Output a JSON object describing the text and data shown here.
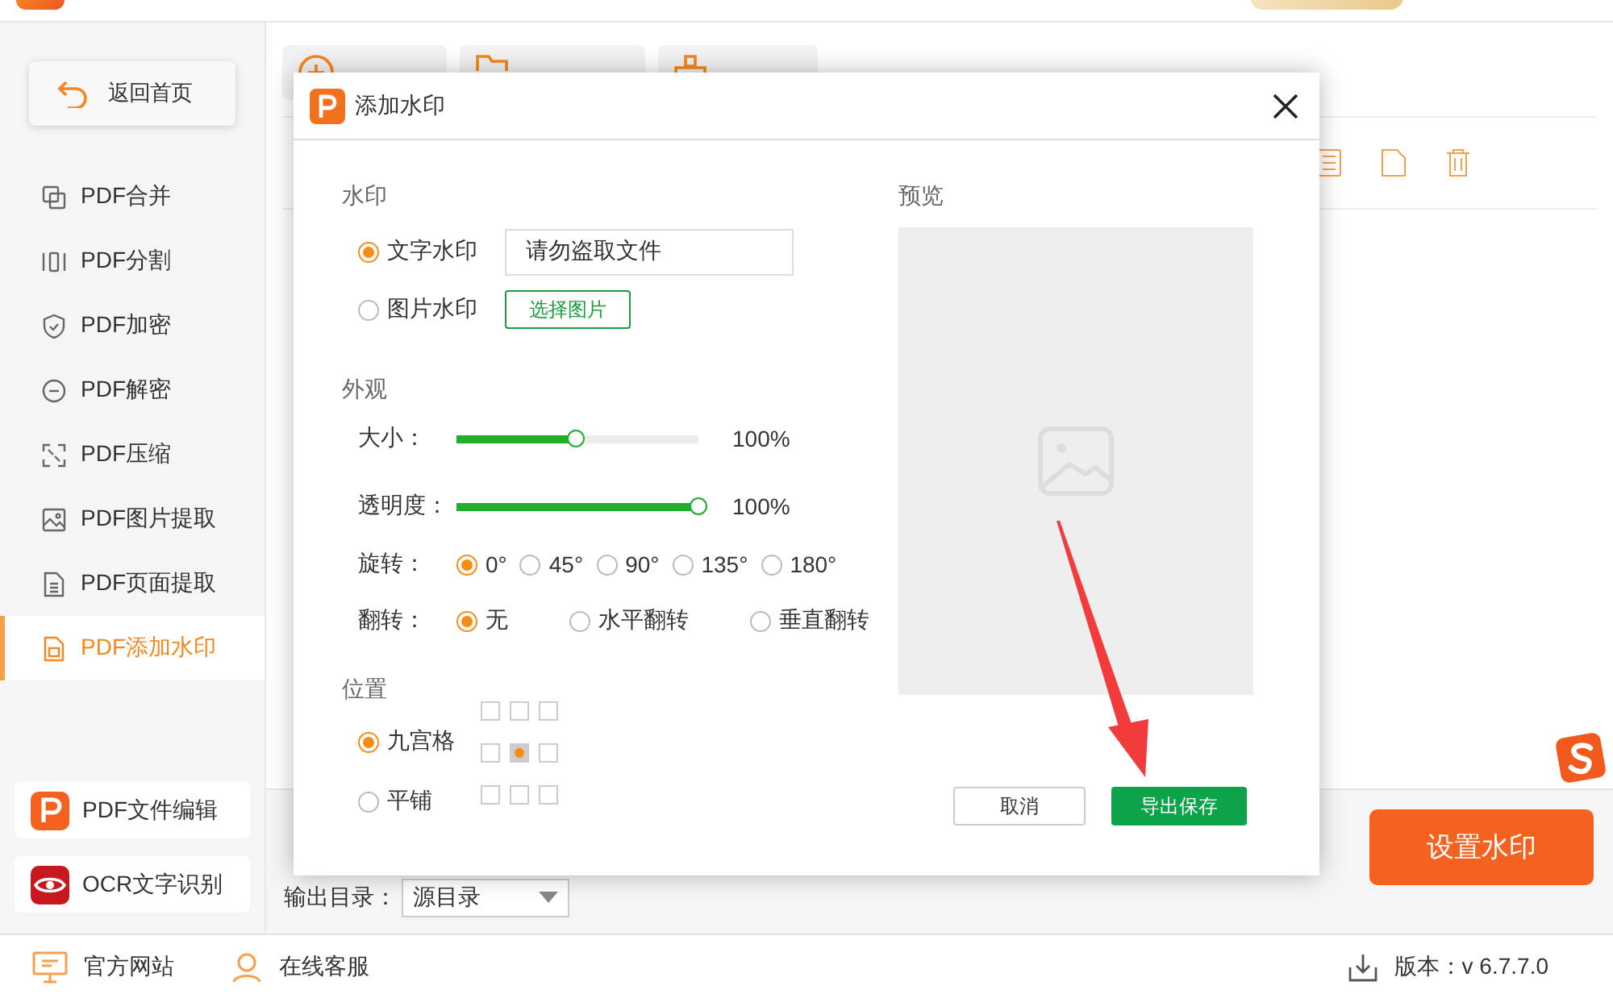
{
  "sidebar": {
    "back_button": "返回首页",
    "items": [
      {
        "label": "PDF合并",
        "kind": "merge",
        "selected": false
      },
      {
        "label": "PDF分割",
        "kind": "split",
        "selected": false
      },
      {
        "label": "PDF加密",
        "kind": "encrypt",
        "selected": false
      },
      {
        "label": "PDF解密",
        "kind": "decrypt",
        "selected": false
      },
      {
        "label": "PDF压缩",
        "kind": "compress",
        "selected": false
      },
      {
        "label": "PDF图片提取",
        "kind": "image",
        "selected": false
      },
      {
        "label": "PDF页面提取",
        "kind": "page",
        "selected": false
      },
      {
        "label": "PDF添加水印",
        "kind": "watermark",
        "selected": true
      }
    ],
    "tools": [
      {
        "label": "PDF文件编辑",
        "kind": "edit"
      },
      {
        "label": "OCR文字识别",
        "kind": "ocr"
      }
    ]
  },
  "toolbar": {
    "buttons": [
      {
        "kind": "add"
      },
      {
        "kind": "folder"
      },
      {
        "kind": "clear"
      }
    ]
  },
  "output": {
    "label": "输出目录：",
    "select": "源目录"
  },
  "start_button": "设置水印",
  "dialog": {
    "title": "添加水印",
    "watermark": {
      "title": "水印",
      "options": [
        {
          "label": "文字水印",
          "kind": "text",
          "selected": true,
          "value": "请勿盗取文件"
        },
        {
          "label": "图片水印",
          "kind": "image",
          "selected": false,
          "button": "选择图片"
        }
      ]
    },
    "appearance": {
      "title": "外观",
      "sliders": [
        {
          "label": "大小：",
          "level": 0.49,
          "reading": "100%"
        },
        {
          "label": "透明度：",
          "level": 1,
          "reading": "100%"
        }
      ],
      "rotation": {
        "label": "旋转：",
        "options": [
          {
            "label": "0°",
            "selected": true
          },
          {
            "label": "45°",
            "selected": false
          },
          {
            "label": "90°",
            "selected": false
          },
          {
            "label": "135°",
            "selected": false
          },
          {
            "label": "180°",
            "selected": false
          }
        ]
      },
      "flip": {
        "label": "翻转：",
        "options": [
          {
            "label": "无",
            "selected": true
          },
          {
            "label": "水平翻转",
            "selected": false
          },
          {
            "label": "垂直翻转",
            "selected": false
          }
        ]
      }
    },
    "position": {
      "title": "位置",
      "modes": [
        {
          "label": "九宫格",
          "selected": true
        },
        {
          "label": "平铺",
          "selected": false
        }
      ],
      "grid": [
        {
          "selected": false
        },
        {
          "selected": false
        },
        {
          "selected": false
        },
        {
          "selected": false
        },
        {
          "selected": true
        },
        {
          "selected": false
        },
        {
          "selected": false
        },
        {
          "selected": false
        },
        {
          "selected": false
        }
      ]
    },
    "preview": {
      "title": "预览"
    },
    "buttons": [
      {
        "label": "取消",
        "kind": "cancel"
      },
      {
        "label": "导出保存",
        "kind": "primary"
      }
    ]
  },
  "footer": {
    "links": [
      {
        "label": "官方网站",
        "kind": "website"
      },
      {
        "label": "在线客服",
        "kind": "support"
      }
    ],
    "version": "版本：v 6.7.7.0"
  }
}
